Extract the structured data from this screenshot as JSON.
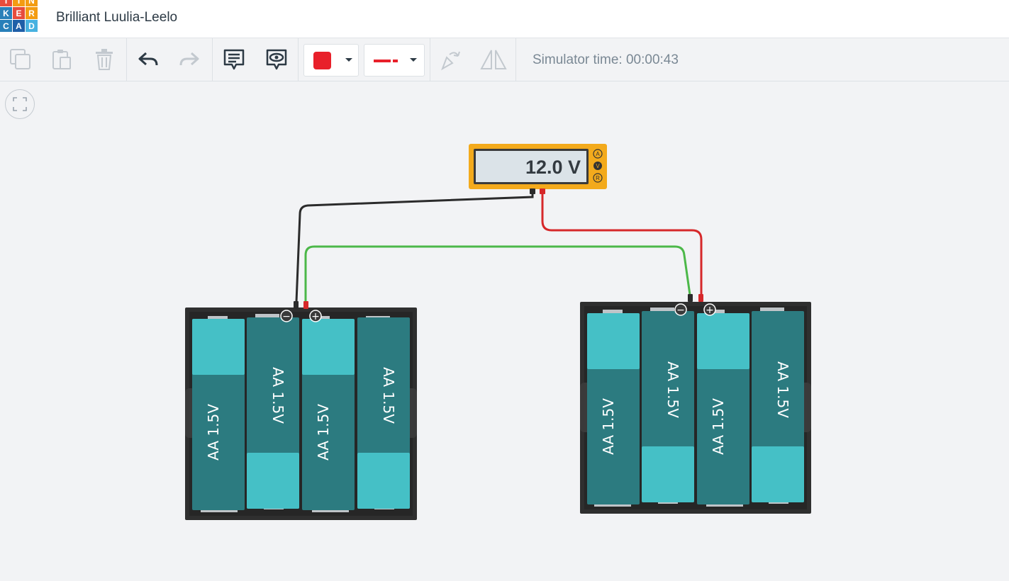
{
  "app": {
    "logo_letters": [
      "T",
      "I",
      "N",
      "K",
      "E",
      "R",
      "C",
      "A",
      "D"
    ],
    "logo_colors": [
      "#e74c3c",
      "#f39c12",
      "#f39c12",
      "#2980b9",
      "#e74c3c",
      "#f39c12",
      "#2980b9",
      "#1f5fa8",
      "#48b2e0"
    ],
    "project_title": "Brilliant Luulia-Leelo"
  },
  "toolbar": {
    "icons": [
      "copy-icon",
      "paste-icon",
      "delete-icon",
      "undo-icon",
      "redo-icon",
      "notes-icon",
      "notes-visibility-icon",
      "color-picker",
      "wire-style-picker",
      "rotate-icon",
      "flip-icon"
    ],
    "wire_color": "#e8202a",
    "simulator_label": "Simulator time: 00:00:43"
  },
  "multimeter": {
    "reading": "12.0 V",
    "modes": [
      "A",
      "V",
      "R"
    ],
    "active_mode": "V"
  },
  "battery_packs": [
    {
      "cells": [
        "AA 1.5V",
        "AA 1.5V",
        "AA 1.5V",
        "AA 1.5V"
      ],
      "terminals": [
        "−",
        "+"
      ]
    },
    {
      "cells": [
        "AA 1.5V",
        "AA 1.5V",
        "AA 1.5V",
        "AA 1.5V"
      ],
      "terminals": [
        "−",
        "+"
      ]
    }
  ],
  "wires": [
    {
      "name": "black-probe-wire",
      "color": "#2b2b2b"
    },
    {
      "name": "red-probe-wire",
      "color": "#d6282a"
    },
    {
      "name": "green-series-wire",
      "color": "#4cb849"
    }
  ]
}
